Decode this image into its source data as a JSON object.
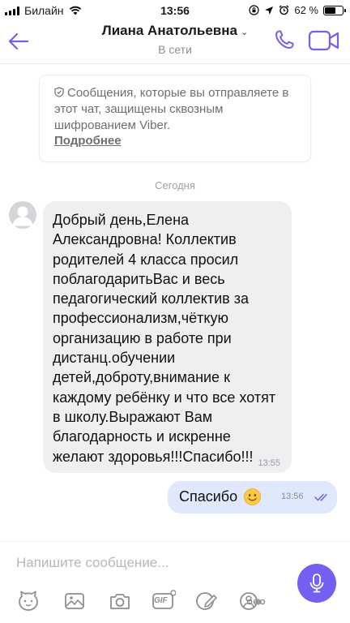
{
  "status_bar": {
    "carrier": "Билайн",
    "time": "13:56",
    "battery": "62 %",
    "battery_level": 0.62
  },
  "header": {
    "contact_name": "Лиана Анатольевна",
    "status": "В сети",
    "icons": {
      "back": "back-arrow-icon",
      "call": "phone-icon",
      "video": "video-camera-icon"
    },
    "accent_color": "#7360f2"
  },
  "encryption_notice": {
    "text": "Сообщения, которые вы отправляете в этот чат, защищены сквозным шифрованием Viber.",
    "link": "Подробнее"
  },
  "date_separator": "Сегодня",
  "messages": [
    {
      "direction": "incoming",
      "text": "Добрый день,Елена Александровна! Коллектив родителей 4 класса просил поблагодаритьВас и весь педагогический коллектив за профессионализм,чёткую организацию в работе при дистанц.обучении детей,доброту,внимание к каждому ребёнку и что все хотят в школу.Выражают Вам благодарность и искренне желают здоровья!!!Спасибо!!!",
      "time": "13:55"
    },
    {
      "direction": "outgoing",
      "text": "Спасибо",
      "emoji": "smiling-face-emoji",
      "time": "13:56",
      "status": "read"
    }
  ],
  "composer": {
    "placeholder": "Напишите сообщение...",
    "toolbar_icons": [
      "sticker-icon",
      "gallery-icon",
      "camera-icon",
      "gif-icon",
      "doodle-icon",
      "share-contact-icon",
      "more-icon"
    ],
    "gif_label": "GIF",
    "more_label": "ooo"
  }
}
